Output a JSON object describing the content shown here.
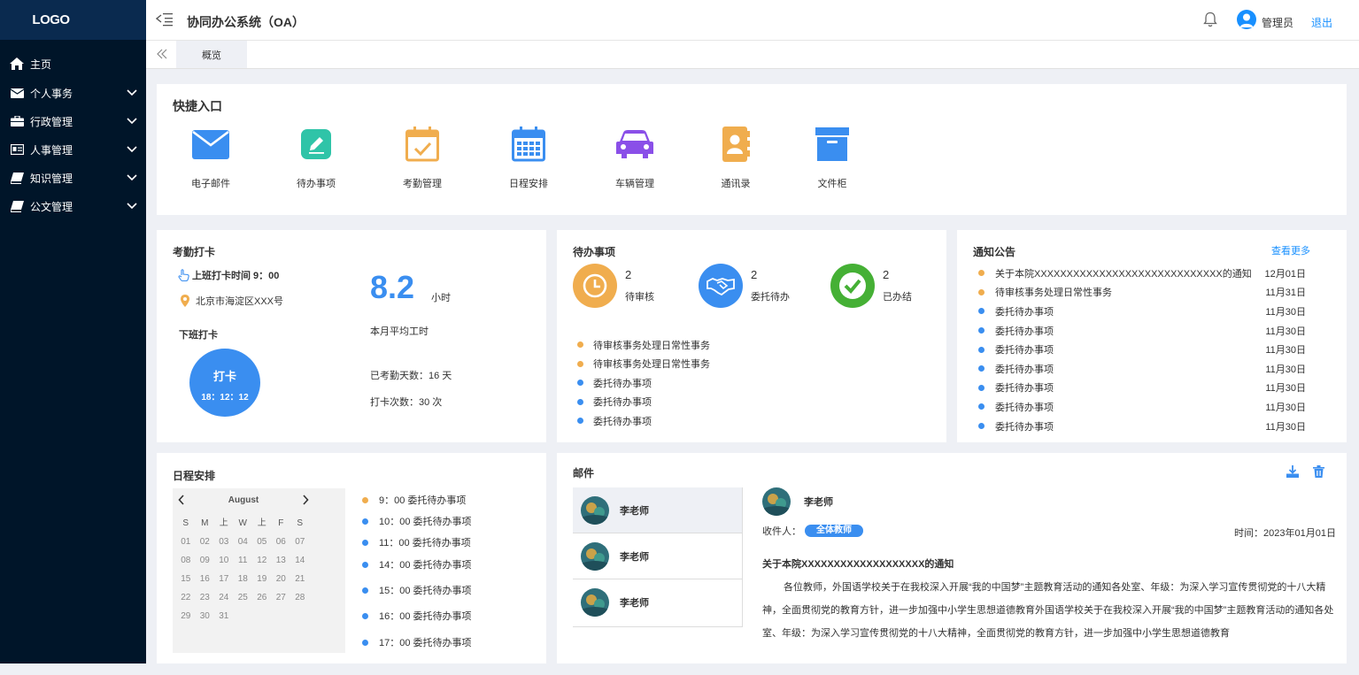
{
  "logo": "LOGO",
  "sidebar": {
    "items": [
      {
        "label": "主页",
        "icon": "home-icon"
      },
      {
        "label": "个人事务",
        "icon": "envelope-icon"
      },
      {
        "label": "行政管理",
        "icon": "briefcase-icon"
      },
      {
        "label": "人事管理",
        "icon": "id-card-icon"
      },
      {
        "label": "知识管理",
        "icon": "book-icon"
      },
      {
        "label": "公文管理",
        "icon": "book-icon"
      }
    ]
  },
  "header": {
    "title": "协同办公系统（OA）",
    "user": "管理员",
    "logout": "退出"
  },
  "tabs": {
    "overview": "概览"
  },
  "quick": {
    "title": "快捷入口",
    "items": [
      {
        "label": "电子邮件",
        "icon": "mail-icon",
        "color": "#3a8ef0"
      },
      {
        "label": "待办事项",
        "icon": "edit-icon",
        "color": "#2fc4a8"
      },
      {
        "label": "考勤管理",
        "icon": "calendar-check-icon",
        "color": "#f0ad4e"
      },
      {
        "label": "日程安排",
        "icon": "calendar-icon",
        "color": "#3a8ef0"
      },
      {
        "label": "车辆管理",
        "icon": "car-icon",
        "color": "#8a4fe8"
      },
      {
        "label": "通讯录",
        "icon": "contacts-icon",
        "color": "#f0ad4e"
      },
      {
        "label": "文件柜",
        "icon": "archive-icon",
        "color": "#3a8ef0"
      }
    ]
  },
  "attendance": {
    "title": "考勤打卡",
    "start_time": "上班打卡时间 9：00",
    "location": "北京市海淀区XXX号",
    "off_label": "下班打卡",
    "punch_label": "打卡",
    "punch_time": "18：12：12",
    "avg_hours": "8.2",
    "avg_unit": "小时",
    "avg_label": "本月平均工时",
    "days": "已考勤天数：16 天",
    "times": "打卡次数：30 次"
  },
  "todo": {
    "title": "待办事项",
    "stats": [
      {
        "count": "2",
        "label": "待审核",
        "color": "#f0ad4e",
        "icon": "clock-icon"
      },
      {
        "count": "2",
        "label": "委托待办",
        "color": "#3a8ef0",
        "icon": "handshake-icon"
      },
      {
        "count": "2",
        "label": "已办结",
        "color": "#45b035",
        "icon": "check-circle-icon"
      }
    ],
    "items": [
      {
        "text": "待审核事务处理日常性事务",
        "color": "#f0ad4e"
      },
      {
        "text": "待审核事务处理日常性事务",
        "color": "#f0ad4e"
      },
      {
        "text": "委托待办事项",
        "color": "#3a8ef0"
      },
      {
        "text": "委托待办事项",
        "color": "#3a8ef0"
      },
      {
        "text": "委托待办事项",
        "color": "#3a8ef0"
      }
    ]
  },
  "notice": {
    "title": "通知公告",
    "more": "查看更多",
    "items": [
      {
        "text": "关于本院XXXXXXXXXXXXXXXXXXXXXXXXXXXXX的通知",
        "date": "12月01日",
        "color": "#f0ad4e"
      },
      {
        "text": "待审核事务处理日常性事务",
        "date": "11月31日",
        "color": "#f0ad4e"
      },
      {
        "text": "委托待办事项",
        "date": "11月30日",
        "color": "#3a8ef0"
      },
      {
        "text": "委托待办事项",
        "date": "11月30日",
        "color": "#3a8ef0"
      },
      {
        "text": "委托待办事项",
        "date": "11月30日",
        "color": "#3a8ef0"
      },
      {
        "text": "委托待办事项",
        "date": "11月30日",
        "color": "#3a8ef0"
      },
      {
        "text": "委托待办事项",
        "date": "11月30日",
        "color": "#3a8ef0"
      },
      {
        "text": "委托待办事项",
        "date": "11月30日",
        "color": "#3a8ef0"
      },
      {
        "text": "委托待办事项",
        "date": "11月30日",
        "color": "#3a8ef0"
      }
    ]
  },
  "schedule": {
    "title": "日程安排",
    "month": "August",
    "weekdays": [
      "S",
      "M",
      "上",
      "W",
      "上",
      "F",
      "S"
    ],
    "days": [
      "01",
      "02",
      "03",
      "04",
      "05",
      "06",
      "07",
      "08",
      "09",
      "10",
      "11",
      "12",
      "13",
      "14",
      "15",
      "16",
      "17",
      "18",
      "19",
      "20",
      "21",
      "22",
      "23",
      "24",
      "25",
      "26",
      "27",
      "28",
      "29",
      "30",
      "31"
    ],
    "events": [
      {
        "text": "9：00  委托待办事项",
        "color": "#f0ad4e"
      },
      {
        "text": "10：00  委托待办事项",
        "color": "#3a8ef0"
      },
      {
        "text": "11：00  委托待办事项",
        "color": "#3a8ef0"
      },
      {
        "text": "14：00  委托待办事项",
        "color": "#3a8ef0"
      },
      {
        "text": "15：00  委托待办事项",
        "color": "#3a8ef0"
      },
      {
        "text": "16：00  委托待办事项",
        "color": "#3a8ef0"
      },
      {
        "text": "17：00  委托待办事项",
        "color": "#3a8ef0"
      }
    ]
  },
  "mail": {
    "title": "邮件",
    "list": [
      {
        "name": "李老师"
      },
      {
        "name": "李老师"
      },
      {
        "name": "李老师"
      }
    ],
    "detail": {
      "sender": "李老师",
      "to_label": "收件人：",
      "to": "全体教师",
      "time": "时间：2023年01月01日",
      "subject": "关于本院XXXXXXXXXXXXXXXXXXX的通知",
      "body": "各位教师，外国语学校关于在我校深入开展“我的中国梦”主题教育活动的通知各处室、年级：为深入学习宣传贯彻党的十八大精神，全面贯彻党的教育方针，进一步加强中小学生思想道德教育外国语学校关于在我校深入开展“我的中国梦”主题教育活动的通知各处室、年级：为深入学习宣传贯彻党的十八大精神，全面贯彻党的教育方针，进一步加强中小学生思想道德教育"
    }
  }
}
